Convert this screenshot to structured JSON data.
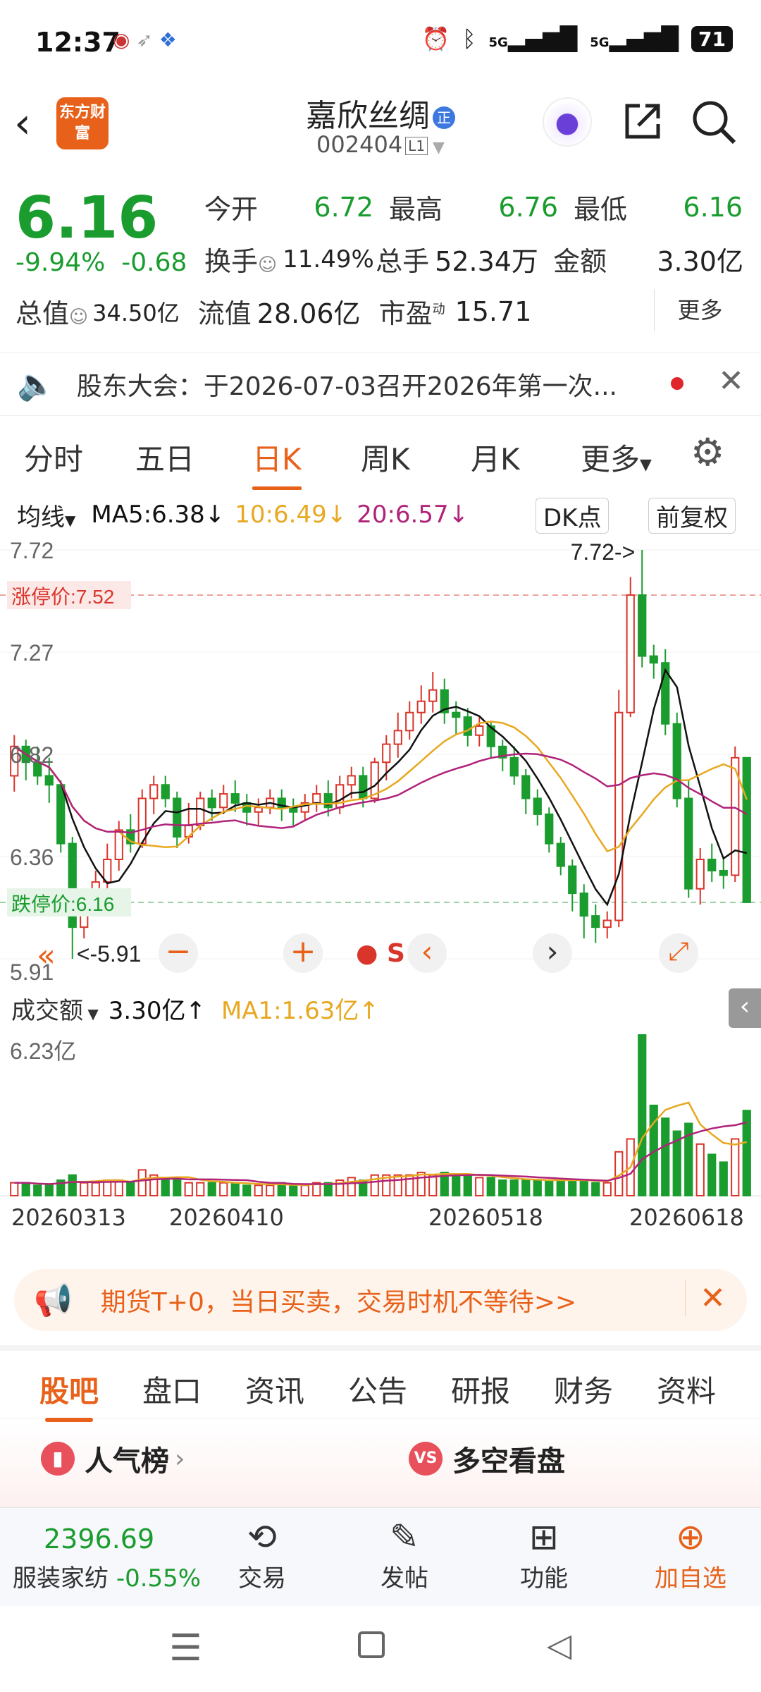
{
  "status_bar": {
    "time": "12:37",
    "signal1": "5G",
    "signal2": "5G",
    "battery": "71"
  },
  "header": {
    "logo_text": "东方财富",
    "stock_name": "嘉欣丝绸",
    "badge": "正",
    "stock_code": "002404",
    "level": "L1"
  },
  "quote": {
    "price": "6.16",
    "change_pct": "-9.94%",
    "change": "-0.68",
    "fields": [
      {
        "label": "今开",
        "value": "6.72"
      },
      {
        "label": "最高",
        "value": "6.76"
      },
      {
        "label": "最低",
        "value": "6.16"
      },
      {
        "label": "换手",
        "value": "11.49%"
      },
      {
        "label": "总手",
        "value": "52.34万"
      },
      {
        "label": "金额",
        "value": "3.30亿"
      },
      {
        "label": "总值",
        "value": "34.50亿"
      },
      {
        "label": "流值",
        "value": "28.06亿"
      },
      {
        "label": "市盈",
        "value": "15.71",
        "sup": "动"
      }
    ],
    "more_label": "更多"
  },
  "notice": {
    "text": "股东大会：于2026-07-03召开2026年第一次..."
  },
  "kline_tabs": [
    "分时",
    "五日",
    "日K",
    "周K",
    "月K",
    "更多"
  ],
  "active_tab": "日K",
  "ma_line": {
    "selector": "均线",
    "ma5": "MA5:6.38",
    "ma10": "10:6.49",
    "ma20": "20:6.57",
    "dk": "DK点",
    "adjust": "前复权"
  },
  "colors": {
    "up": "#d9352a",
    "down": "#1a9c2e",
    "accent": "#e8611a",
    "ma5": "#111111",
    "ma10": "#e8a820",
    "ma20": "#b0237a"
  },
  "chart_data": {
    "type": "candlestick",
    "y_ticks": [
      "7.72",
      "7.27",
      "6.82",
      "6.36",
      "5.91"
    ],
    "ylim": [
      5.91,
      7.72
    ],
    "limit_up": {
      "label": "涨停价:7.52",
      "value": 7.52
    },
    "limit_down": {
      "label": "跌停价:6.16",
      "value": 6.16
    },
    "high_annotation": "7.72->",
    "low_annotation": "<-5.91",
    "candles": [
      [
        6.72,
        6.85,
        6.9,
        6.65
      ],
      [
        6.85,
        6.78,
        6.88,
        6.7
      ],
      [
        6.78,
        6.72,
        6.85,
        6.68
      ],
      [
        6.72,
        6.68,
        6.8,
        6.6
      ],
      [
        6.68,
        6.42,
        6.7,
        6.38
      ],
      [
        6.42,
        6.05,
        6.45,
        5.91
      ],
      [
        6.05,
        6.15,
        6.2,
        6.0
      ],
      [
        6.15,
        6.25,
        6.3,
        6.1
      ],
      [
        6.25,
        6.35,
        6.42,
        6.2
      ],
      [
        6.35,
        6.48,
        6.52,
        6.3
      ],
      [
        6.48,
        6.42,
        6.55,
        6.38
      ],
      [
        6.42,
        6.62,
        6.66,
        6.4
      ],
      [
        6.62,
        6.68,
        6.72,
        6.55
      ],
      [
        6.68,
        6.62,
        6.72,
        6.58
      ],
      [
        6.62,
        6.45,
        6.65,
        6.4
      ],
      [
        6.45,
        6.5,
        6.6,
        6.42
      ],
      [
        6.5,
        6.62,
        6.65,
        6.48
      ],
      [
        6.62,
        6.58,
        6.66,
        6.52
      ],
      [
        6.58,
        6.64,
        6.68,
        6.55
      ],
      [
        6.64,
        6.6,
        6.7,
        6.56
      ],
      [
        6.6,
        6.56,
        6.64,
        6.5
      ],
      [
        6.56,
        6.58,
        6.62,
        6.5
      ],
      [
        6.58,
        6.62,
        6.66,
        6.55
      ],
      [
        6.62,
        6.58,
        6.66,
        6.52
      ],
      [
        6.58,
        6.56,
        6.62,
        6.5
      ],
      [
        6.56,
        6.6,
        6.64,
        6.52
      ],
      [
        6.6,
        6.64,
        6.68,
        6.56
      ],
      [
        6.64,
        6.58,
        6.7,
        6.54
      ],
      [
        6.58,
        6.68,
        6.72,
        6.55
      ],
      [
        6.68,
        6.72,
        6.76,
        6.62
      ],
      [
        6.72,
        6.62,
        6.76,
        6.58
      ],
      [
        6.62,
        6.78,
        6.8,
        6.6
      ],
      [
        6.78,
        6.86,
        6.9,
        6.7
      ],
      [
        6.86,
        6.92,
        7.0,
        6.8
      ],
      [
        6.92,
        7.0,
        7.05,
        6.88
      ],
      [
        7.0,
        7.05,
        7.12,
        6.95
      ],
      [
        7.05,
        7.1,
        7.18,
        7.0
      ],
      [
        7.1,
        7.0,
        7.15,
        6.95
      ],
      [
        7.0,
        6.98,
        7.05,
        6.9
      ],
      [
        6.98,
        6.9,
        7.02,
        6.85
      ],
      [
        6.9,
        6.94,
        6.98,
        6.85
      ],
      [
        6.94,
        6.85,
        6.96,
        6.8
      ],
      [
        6.85,
        6.8,
        6.88,
        6.74
      ],
      [
        6.8,
        6.72,
        6.85,
        6.68
      ],
      [
        6.72,
        6.62,
        6.75,
        6.55
      ],
      [
        6.62,
        6.55,
        6.66,
        6.5
      ],
      [
        6.55,
        6.42,
        6.58,
        6.38
      ],
      [
        6.42,
        6.32,
        6.45,
        6.28
      ],
      [
        6.32,
        6.2,
        6.35,
        6.12
      ],
      [
        6.2,
        6.1,
        6.24,
        6.0
      ],
      [
        6.1,
        6.05,
        6.15,
        5.98
      ],
      [
        6.05,
        6.08,
        6.12,
        6.0
      ],
      [
        6.08,
        7.0,
        7.1,
        6.05
      ],
      [
        7.0,
        7.52,
        7.6,
        6.98
      ],
      [
        7.52,
        7.25,
        7.72,
        7.2
      ],
      [
        7.25,
        7.22,
        7.3,
        7.15
      ],
      [
        7.22,
        6.95,
        7.28,
        6.9
      ],
      [
        6.95,
        6.62,
        7.0,
        6.58
      ],
      [
        6.62,
        6.22,
        6.7,
        6.18
      ],
      [
        6.22,
        6.35,
        6.4,
        6.15
      ],
      [
        6.35,
        6.3,
        6.42,
        6.25
      ],
      [
        6.3,
        6.28,
        6.36,
        6.22
      ],
      [
        6.28,
        6.8,
        6.85,
        6.25
      ],
      [
        6.8,
        6.16,
        6.76,
        6.16
      ]
    ],
    "volume_y_tick": "6.23亿",
    "volume_max": 6.23,
    "volumes": [
      0.5,
      0.5,
      0.4,
      0.4,
      0.6,
      0.8,
      0.5,
      0.5,
      0.6,
      0.6,
      0.5,
      1.0,
      0.8,
      0.6,
      0.7,
      0.5,
      0.5,
      0.5,
      0.5,
      0.5,
      0.4,
      0.4,
      0.4,
      0.5,
      0.4,
      0.4,
      0.5,
      0.5,
      0.6,
      0.7,
      0.6,
      0.8,
      0.8,
      0.8,
      0.8,
      0.9,
      0.8,
      0.9,
      0.8,
      0.8,
      0.7,
      0.7,
      0.6,
      0.6,
      0.6,
      0.6,
      0.6,
      0.6,
      0.6,
      0.6,
      0.5,
      0.5,
      1.7,
      2.2,
      6.23,
      3.5,
      3.0,
      2.5,
      2.8,
      2.0,
      1.6,
      1.3,
      2.2,
      3.3
    ],
    "x_ticks": [
      "20260313",
      "20260410",
      "20260518",
      "20260618"
    ]
  },
  "volume_info": {
    "selector": "成交额",
    "value": "3.30亿",
    "ma1": "MA1:1.63亿"
  },
  "promo": {
    "text": "期货T+0，当日买卖，交易时机不等待>>"
  },
  "bottom_tabs": [
    "股吧",
    "盘口",
    "资讯",
    "公告",
    "研报",
    "财务",
    "资料"
  ],
  "cards": [
    {
      "title": "人气榜"
    },
    {
      "title": "多空看盘"
    }
  ],
  "nav": {
    "index_value": "2396.69",
    "index_name": "服装家纺",
    "index_change": "-0.55%",
    "items": [
      "交易",
      "发帖",
      "功能",
      "加自选"
    ]
  }
}
